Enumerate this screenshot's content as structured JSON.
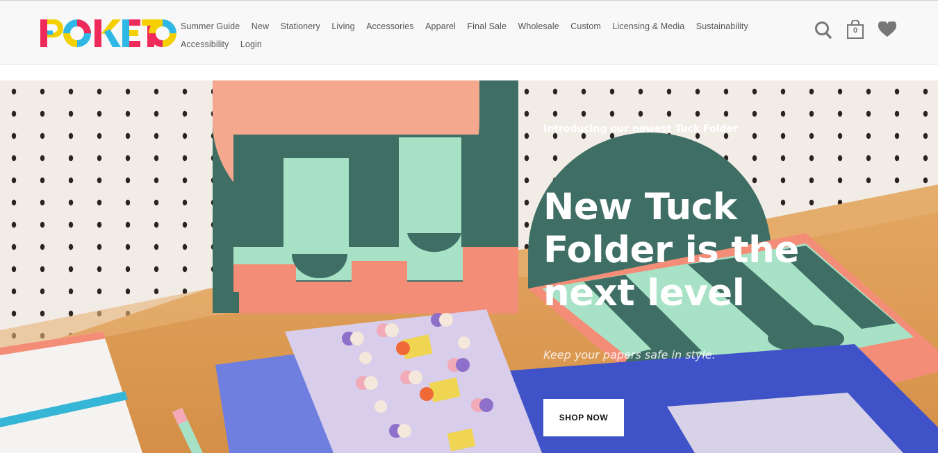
{
  "brand": {
    "name": "POKETO",
    "logo_colors": [
      "#ee2a5b",
      "#f5d000",
      "#2fb8e6",
      "#ee2a5b",
      "#f5d000",
      "#2fb8e6"
    ]
  },
  "nav": {
    "row1": [
      "Summer Guide",
      "New",
      "Stationery",
      "Living",
      "Accessories",
      "Apparel",
      "Final Sale",
      "Wholesale",
      "Custom",
      "Licensing & Media",
      "Sustainability"
    ],
    "row2": [
      "Accessibility",
      "Login"
    ]
  },
  "header_icons": {
    "search": "search-icon",
    "cart": "shopping-bag-icon",
    "cart_count": "0",
    "wishlist": "heart-icon"
  },
  "hero": {
    "eyebrow": "Introducing our newest Tuck Folder",
    "title": "New Tuck Folder is the next level",
    "subtitle": "Keep your papers safe in style.",
    "cta": "SHOP NOW"
  },
  "colors": {
    "header_bg": "#f8f8f8",
    "nav_text": "#555555",
    "icon_gray": "#777777",
    "hero_text": "#ffffff",
    "folder_teal": "#3f6e65",
    "folder_mint": "#a8e2c6",
    "folder_coral": "#f48d78",
    "folder_blue": "#5567d6"
  }
}
